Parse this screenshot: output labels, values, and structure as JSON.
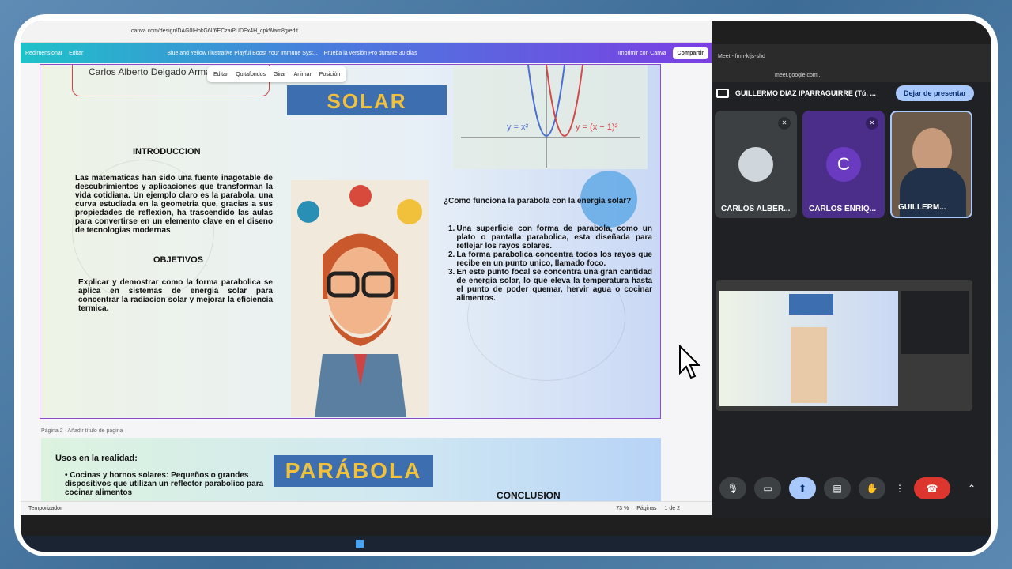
{
  "canva": {
    "url": "canva.com/design/DAG0lHokG6I/6ECzaiPUDEx4H_cpkWam8g/edit",
    "menu": {
      "resize": "Redimensionar",
      "edit": "Editar",
      "doc_title": "Blue and Yellow Illustrative Playful Boost Your Immune Syst...",
      "pro": "Prueba la versión Pro durante 30 días",
      "print": "Imprimir con Canva",
      "share": "Compartir"
    },
    "toolbar": {
      "edit": "Editar",
      "remove_bg": "Quitafondos",
      "flip": "Girar",
      "animate": "Animar",
      "position": "Posición"
    },
    "page1": {
      "author": "Carlos Alberto Delgado Armas",
      "solar": "SOLAR",
      "eq1": "y = x²",
      "eq2": "y = (x − 1)²",
      "intro_title": "INTRODUCCION",
      "intro_text": "Las matematicas han sido una fuente inagotable de descubrimientos y aplicaciones que transforman la vida cotidiana. Un ejemplo claro es la parabola, una curva estudiada en la geometria que, gracias a sus propiedades de reflexion, ha trascendido las aulas para convertirse en un elemento clave en el diseno de tecnologias modernas",
      "obj_title": "OBJETIVOS",
      "obj_text": "Explicar y demostrar como la forma parabolica se aplica en sistemas de energia solar para concentrar la radiacion solar y mejorar la eficiencia termica.",
      "question": "¿Como funciona la parabola con la energia solar?",
      "steps": [
        "Una superficie con forma de parabola, como un plato o pantalla parabolica, esta diseñada para reflejar los rayos solares.",
        "La forma parabolica concentra todos los rayos que recibe en un punto unico, llamado foco.",
        "En este punto focal se concentra una gran cantidad de energia solar, lo que eleva la temperatura hasta el punto de poder quemar, hervir agua o cocinar alimentos."
      ]
    },
    "page2_label": "Página 2 · Añadir título de página",
    "page2": {
      "uses_title": "Usos en la realidad:",
      "bullet": "Cocinas y hornos solares: Pequeños o grandes dispositivos que utilizan un reflector parabolico para cocinar alimentos",
      "parabola": "PARÁBOLA",
      "conclusion": "CONCLUSION"
    },
    "footer": {
      "timer": "Temporizador",
      "zoom": "73 %",
      "pages": "Páginas",
      "page_count": "1 de 2"
    }
  },
  "meet": {
    "tab": "Meet - fmn-kfjs-shd",
    "url": "meet.google.com...",
    "presenter": "GUILLERMO DIAZ IPARRAGUIRRE (Tú, ...",
    "stop_presenting": "Dejar de presentar",
    "participants": [
      {
        "name": "CARLOS ALBER...",
        "initial": ""
      },
      {
        "name": "CARLOS ENRIQ...",
        "initial": "C"
      },
      {
        "name": "GUILLERM...",
        "initial": ""
      }
    ]
  },
  "colors": {
    "brand_blue": "#3d6fb0",
    "title_yellow": "#f2c13c",
    "leave_red": "#dc362e",
    "present_blue": "#a8c7fa"
  }
}
